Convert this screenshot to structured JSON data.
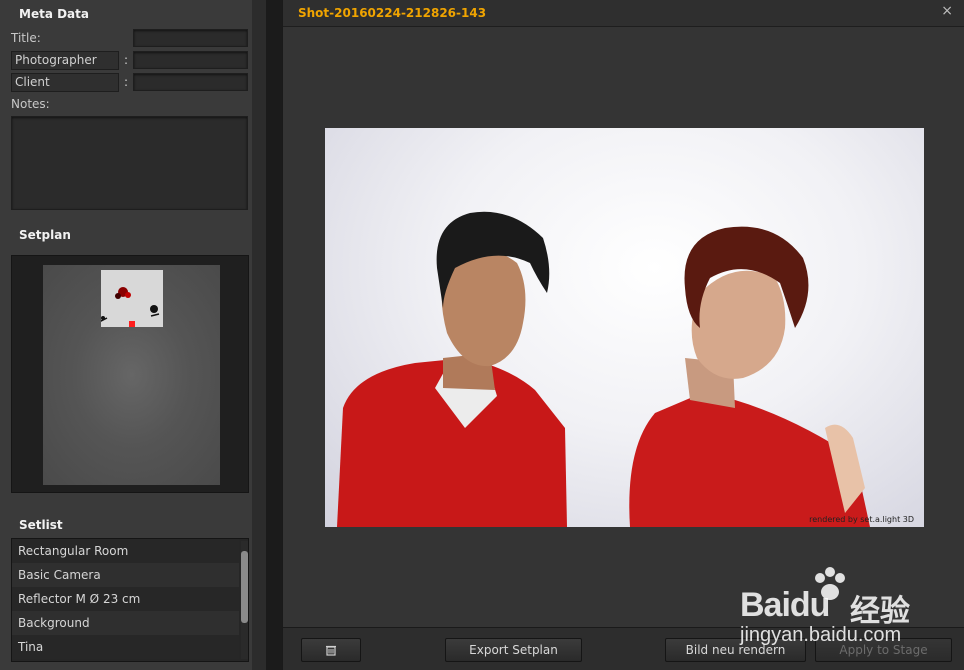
{
  "meta": {
    "section_title": "Meta Data",
    "title_label": "Title:",
    "photographer_label": "Photographer",
    "client_label": "Client",
    "notes_label": "Notes:",
    "colon": ":"
  },
  "setplan": {
    "section_title": "Setplan"
  },
  "setlist": {
    "section_title": "Setlist",
    "items": [
      "Rectangular Room",
      "Basic Camera",
      "Reflector M Ø 23 cm",
      "Background",
      "Tina"
    ]
  },
  "shot": {
    "title": "Shot-20160224-212826-143",
    "watermark": "rendered by set.a.light 3D"
  },
  "buttons": {
    "export": "Export Setplan",
    "rerender": "Bild neu rendern",
    "apply": "Apply to Stage"
  },
  "icons": {
    "close": "×",
    "delete": "trash-icon"
  },
  "overlay": {
    "brand": "Baidu",
    "brand_cn": "经验",
    "url": "jingyan.baidu.com"
  },
  "colors": {
    "accent": "#f0a400"
  }
}
